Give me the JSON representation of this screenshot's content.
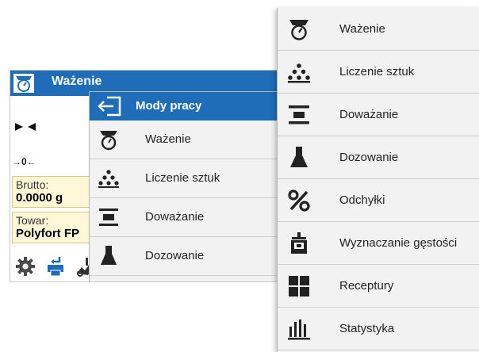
{
  "device": {
    "title": "Ważenie",
    "zero_indicator": "→0←",
    "brutto": {
      "label": "Brutto:",
      "value": "0.0000 g"
    },
    "towar": {
      "label": "Towar:",
      "value": "Polyfort FP"
    }
  },
  "mini_menu": {
    "title": "Mody pracy",
    "items": [
      {
        "label": "Ważenie",
        "icon": "weighing-icon"
      },
      {
        "label": "Liczenie sztuk",
        "icon": "parts-counting-icon"
      },
      {
        "label": "Doważanie",
        "icon": "checkweighing-icon"
      },
      {
        "label": "Dozowanie",
        "icon": "dosing-icon"
      }
    ]
  },
  "big_menu": {
    "items": [
      {
        "label": "Ważenie",
        "icon": "weighing-icon"
      },
      {
        "label": "Liczenie sztuk",
        "icon": "parts-counting-icon"
      },
      {
        "label": "Doważanie",
        "icon": "checkweighing-icon"
      },
      {
        "label": "Dozowanie",
        "icon": "dosing-icon"
      },
      {
        "label": "Odchyłki",
        "icon": "percent-icon"
      },
      {
        "label": "Wyznaczanie gęstości",
        "icon": "density-icon"
      },
      {
        "label": "Receptury",
        "icon": "formulation-icon"
      },
      {
        "label": "Statystyka",
        "icon": "statistics-icon"
      }
    ]
  },
  "colors": {
    "accent": "#1f6db8",
    "field_bg": "#fff8d8",
    "menu_bg": "#f2f2f2"
  }
}
